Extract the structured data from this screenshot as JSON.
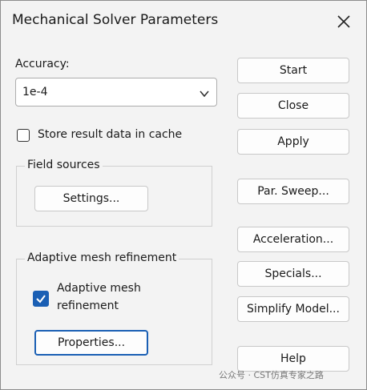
{
  "window": {
    "title": "Mechanical Solver Parameters",
    "close_icon": "close-icon"
  },
  "accuracy": {
    "label": "Accuracy:",
    "value": "1e-4"
  },
  "cache": {
    "label": "Store result data in cache",
    "checked": false
  },
  "field_sources": {
    "title": "Field sources",
    "settings_button": "Settings..."
  },
  "adaptive": {
    "title": "Adaptive mesh refinement",
    "checkbox_line1": "Adaptive mesh",
    "checkbox_line2": "refinement",
    "checked": true,
    "properties_button": "Properties..."
  },
  "buttons": {
    "start": "Start",
    "close": "Close",
    "apply": "Apply",
    "par_sweep": "Par. Sweep...",
    "acceleration": "Acceleration...",
    "specials": "Specials...",
    "simplify_model": "Simplify Model...",
    "help": "Help"
  },
  "watermark": {
    "text": "公众号 · CST仿真专家之路"
  },
  "colors": {
    "accent": "#1a5fb4",
    "background": "#f3f3f3"
  }
}
